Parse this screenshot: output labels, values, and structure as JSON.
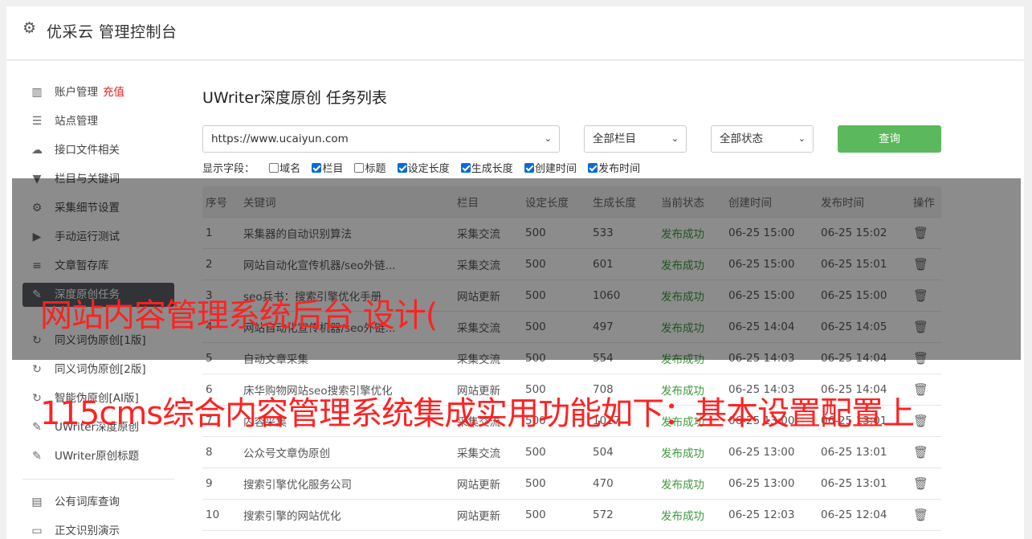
{
  "header": {
    "title": "优采云 管理控制台",
    "icon": "gear-icon"
  },
  "sidebar": {
    "items": [
      {
        "label": "账户管理",
        "extra": "充值",
        "icon": "bar-chart-icon"
      },
      {
        "label": "站点管理",
        "icon": "server-icon"
      },
      {
        "label": "接口文件相关",
        "icon": "cloud-upload-icon"
      },
      {
        "label": "栏目与关键词",
        "icon": "filter-icon"
      },
      {
        "label": "采集细节设置",
        "icon": "cogs-icon"
      },
      {
        "label": "手动运行测试",
        "icon": "play-circle-icon"
      },
      {
        "label": "文章暂存库",
        "icon": "database-icon"
      },
      {
        "label": "深度原创任务",
        "icon": "edit-icon",
        "active": true
      },
      {
        "label": "同义词伪原创[1版]",
        "icon": "refresh-icon"
      },
      {
        "label": "同义词伪原创[2版]",
        "icon": "refresh-icon"
      },
      {
        "label": "智能伪原创[AI版]",
        "icon": "refresh-icon"
      },
      {
        "label": "UWriter深度原创",
        "icon": "edit-icon"
      },
      {
        "label": "UWriter原创标题",
        "icon": "edit-icon"
      },
      {
        "label": "公有词库查询",
        "icon": "book-icon"
      },
      {
        "label": "正文识别演示",
        "icon": "desktop-icon"
      }
    ]
  },
  "main": {
    "title": "UWriter深度原创 任务列表",
    "filters": {
      "site": "https://www.ucaiyun.com",
      "column": "全部栏目",
      "status": "全部状态",
      "query_label": "查询"
    },
    "fields": {
      "label": "显示字段：",
      "options": [
        {
          "label": "域名",
          "checked": false
        },
        {
          "label": "栏目",
          "checked": true
        },
        {
          "label": "标题",
          "checked": false
        },
        {
          "label": "设定长度",
          "checked": true
        },
        {
          "label": "生成长度",
          "checked": true
        },
        {
          "label": "创建时间",
          "checked": true
        },
        {
          "label": "发布时间",
          "checked": true
        }
      ]
    },
    "table": {
      "headers": [
        "序号",
        "关键词",
        "栏目",
        "设定长度",
        "生成长度",
        "当前状态",
        "创建时间",
        "发布时间",
        "操作"
      ],
      "rows": [
        [
          "1",
          "采集器的自动识别算法",
          "采集交流",
          "500",
          "533",
          "发布成功",
          "06-25 15:00",
          "06-25 15:02"
        ],
        [
          "2",
          "网站自动化宣传机器/seo外链...",
          "采集交流",
          "500",
          "601",
          "发布成功",
          "06-25 15:00",
          "06-25 15:01"
        ],
        [
          "3",
          "seo兵书：搜索引擎优化手册",
          "网站更新",
          "500",
          "1060",
          "发布成功",
          "06-25 15:00",
          "06-25 15:00"
        ],
        [
          "4",
          "网站自动化宣传机器/seo外链...",
          "采集交流",
          "500",
          "497",
          "发布成功",
          "06-25 14:04",
          "06-25 14:05"
        ],
        [
          "5",
          "自动文章采集",
          "采集交流",
          "500",
          "554",
          "发布成功",
          "06-25 14:03",
          "06-25 14:04"
        ],
        [
          "6",
          "床华购物网站seo搜索引擎优化",
          "网站更新",
          "500",
          "708",
          "发布成功",
          "06-25 14:03",
          "06-25 14:04"
        ],
        [
          "7",
          "内容采集",
          "采集交流",
          "500",
          "1017",
          "发布成功",
          "06-25 13:00",
          "06-25 13:01"
        ],
        [
          "8",
          "公众号文章伪原创",
          "采集交流",
          "500",
          "504",
          "发布成功",
          "06-25 13:00",
          "06-25 13:01"
        ],
        [
          "9",
          "搜索引擎优化服务公司",
          "网站更新",
          "500",
          "470",
          "发布成功",
          "06-25 13:00",
          "06-25 13:01"
        ],
        [
          "10",
          "搜索引擎的网站优化",
          "网站更新",
          "500",
          "572",
          "发布成功",
          "06-25 12:03",
          "06-25 12:04"
        ]
      ],
      "delete_icon": "trash-icon"
    }
  },
  "overlay": {
    "line1": "网站内容管理系统后台 设计(",
    "line2": "115cms综合内容管理系统集成实用功能如下：基本设置配置上"
  }
}
